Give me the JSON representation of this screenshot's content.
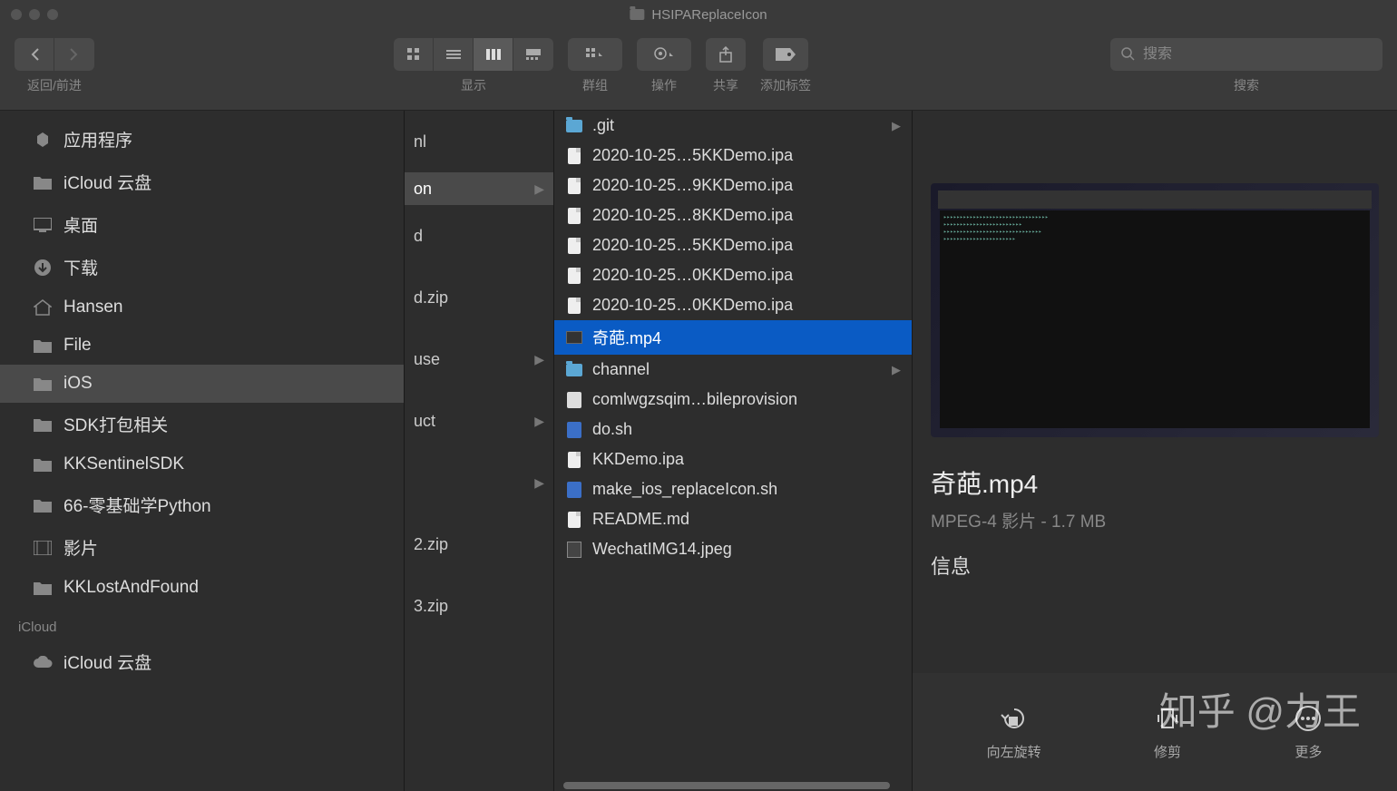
{
  "window": {
    "title": "HSIPAReplaceIcon"
  },
  "toolbar": {
    "nav_label": "返回/前进",
    "view_label": "显示",
    "group_label": "群组",
    "action_label": "操作",
    "share_label": "共享",
    "tags_label": "添加标签",
    "search_label": "搜索",
    "search_placeholder": "搜索"
  },
  "sidebar": {
    "items": [
      {
        "label": "应用程序",
        "icon": "apps"
      },
      {
        "label": "iCloud 云盘",
        "icon": "folder"
      },
      {
        "label": "桌面",
        "icon": "desktop"
      },
      {
        "label": "下载",
        "icon": "download"
      },
      {
        "label": "Hansen",
        "icon": "home"
      },
      {
        "label": "File",
        "icon": "folder"
      },
      {
        "label": "iOS",
        "icon": "folder",
        "selected": true
      },
      {
        "label": "SDK打包相关",
        "icon": "folder"
      },
      {
        "label": "KKSentinelSDK",
        "icon": "folder"
      },
      {
        "label": "66-零基础学Python",
        "icon": "folder"
      },
      {
        "label": "影片",
        "icon": "movie"
      },
      {
        "label": "KKLostAndFound",
        "icon": "folder"
      }
    ],
    "section_header": "iCloud",
    "icloud_item": "iCloud 云盘"
  },
  "column1": {
    "items": [
      {
        "label": "nl",
        "folder": false
      },
      {
        "label": "on",
        "folder": true,
        "selected": true
      },
      {
        "label": "d",
        "folder": false
      },
      {
        "label": "d.zip",
        "folder": false
      },
      {
        "label": "use",
        "folder": true
      },
      {
        "label": "uct",
        "folder": true
      },
      {
        "label": "",
        "folder": true
      },
      {
        "label": "2.zip",
        "folder": false
      },
      {
        "label": "3.zip",
        "folder": false
      }
    ]
  },
  "column2": {
    "items": [
      {
        "label": ".git",
        "icon": "folder",
        "hasChildren": true
      },
      {
        "label": "2020-10-25…5KKDemo.ipa",
        "icon": "doc"
      },
      {
        "label": "2020-10-25…9KKDemo.ipa",
        "icon": "doc"
      },
      {
        "label": "2020-10-25…8KKDemo.ipa",
        "icon": "doc"
      },
      {
        "label": "2020-10-25…5KKDemo.ipa",
        "icon": "doc"
      },
      {
        "label": "2020-10-25…0KKDemo.ipa",
        "icon": "doc"
      },
      {
        "label": "2020-10-25…0KKDemo.ipa",
        "icon": "doc"
      },
      {
        "label": "奇葩.mp4",
        "icon": "video",
        "selected": true
      },
      {
        "label": "channel",
        "icon": "folder",
        "hasChildren": true
      },
      {
        "label": "comlwgzsqim…bileprovision",
        "icon": "prov"
      },
      {
        "label": "do.sh",
        "icon": "sh"
      },
      {
        "label": "KKDemo.ipa",
        "icon": "doc"
      },
      {
        "label": "make_ios_replaceIcon.sh",
        "icon": "sh"
      },
      {
        "label": "README.md",
        "icon": "doc"
      },
      {
        "label": "WechatIMG14.jpeg",
        "icon": "img"
      }
    ]
  },
  "preview": {
    "filename": "奇葩.mp4",
    "type": "MPEG-4 影片",
    "size": "1.7 MB",
    "info_label": "信息"
  },
  "actions": {
    "rotate_left": "向左旋转",
    "trim": "修剪",
    "more": "更多"
  },
  "watermark": "知乎 @力王"
}
